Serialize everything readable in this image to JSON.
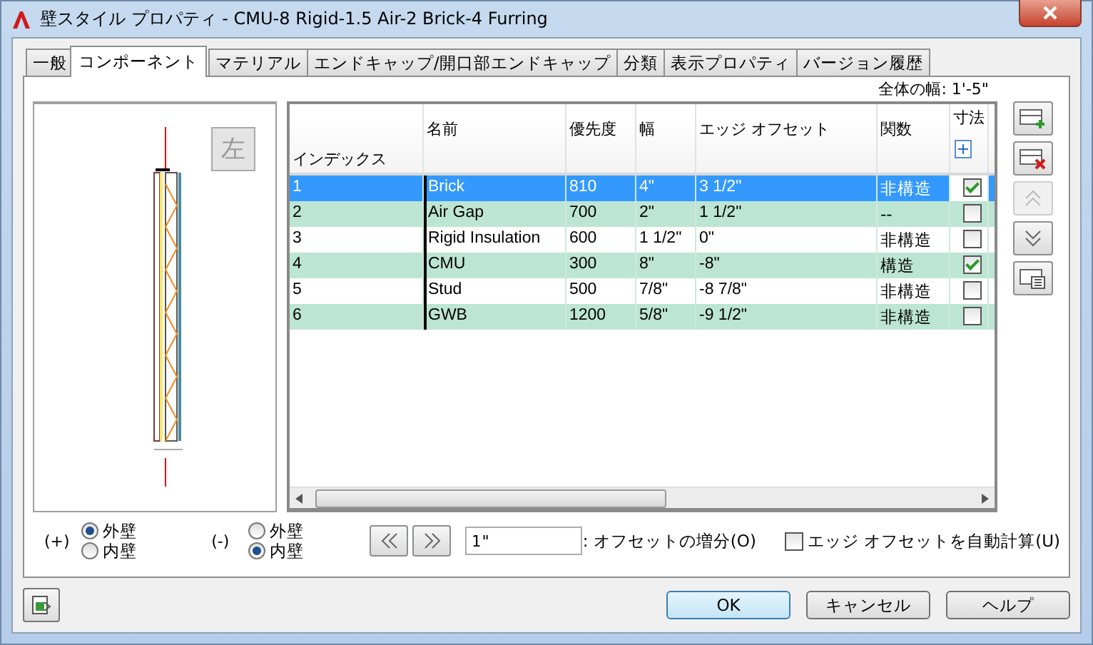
{
  "window": {
    "title": "壁スタイル プロパティ - CMU-8 Rigid-1.5 Air-2 Brick-4 Furring"
  },
  "tabs": [
    {
      "label": "一般",
      "selected": false
    },
    {
      "label": "コンポーネント",
      "selected": true
    },
    {
      "label": "マテリアル",
      "selected": false
    },
    {
      "label": "エンドキャップ/開口部エンドキャップ",
      "selected": false
    },
    {
      "label": "分類",
      "selected": false
    },
    {
      "label": "表示プロパティ",
      "selected": false
    },
    {
      "label": "バージョン履歴",
      "selected": false
    }
  ],
  "total_width": "全体の幅: 1'-5\"",
  "side_button": "左",
  "table": {
    "columns": [
      "インデックス",
      "名前",
      "優先度",
      "幅",
      "エッジ オフセット",
      "関数",
      "寸法"
    ],
    "rows": [
      {
        "cells": [
          "1",
          "Brick",
          "810",
          "4\"",
          "3 1/2\"",
          "非構造"
        ],
        "checked": true,
        "selected": true
      },
      {
        "cells": [
          "2",
          "Air Gap",
          "700",
          "2\"",
          "1 1/2\"",
          "--"
        ],
        "checked": false,
        "selected": false
      },
      {
        "cells": [
          "3",
          "Rigid Insulation",
          "600",
          "1 1/2\"",
          "0\"",
          "非構造"
        ],
        "checked": false,
        "selected": false
      },
      {
        "cells": [
          "4",
          "CMU",
          "300",
          "8\"",
          "-8\"",
          "構造"
        ],
        "checked": true,
        "selected": false
      },
      {
        "cells": [
          "5",
          "Stud",
          "500",
          "7/8\"",
          "-8 7/8\"",
          "非構造"
        ],
        "checked": false,
        "selected": false
      },
      {
        "cells": [
          "6",
          "GWB",
          "1200",
          "5/8\"",
          "-9 1/2\"",
          "非構造"
        ],
        "checked": false,
        "selected": false
      }
    ]
  },
  "plus_side": {
    "label": "(+)",
    "options": [
      {
        "label": "外壁",
        "selected": true
      },
      {
        "label": "内壁",
        "selected": false
      }
    ]
  },
  "minus_side": {
    "label": "(-)",
    "options": [
      {
        "label": "外壁",
        "selected": false
      },
      {
        "label": "内壁",
        "selected": true
      }
    ]
  },
  "offset_increment": {
    "value": "1\"",
    "label": ": オフセットの増分(O)"
  },
  "auto_offset": {
    "label": "エッジ オフセットを自動計算(U)",
    "checked": false
  },
  "buttons": [
    "OK",
    "キャンセル",
    "ヘルプ"
  ]
}
